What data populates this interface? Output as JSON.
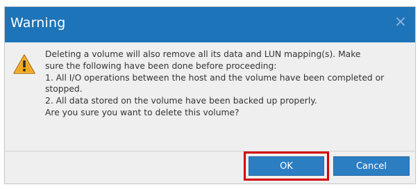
{
  "dialog": {
    "title": "Warning",
    "close_glyph": "×",
    "icon": "warning-triangle-icon",
    "message_lines": [
      "Deleting a volume will also remove all its data and LUN mapping(s). Make",
      "sure the following have been done before proceeding:",
      "1. All I/O operations between the host and the volume have been completed or",
      "stopped.",
      "2. All data stored on the volume have been backed up properly.",
      "Are you sure you want to delete this volume?"
    ],
    "buttons": {
      "ok_label": "OK",
      "cancel_label": "Cancel"
    }
  },
  "colors": {
    "titlebar": "#1e74b8",
    "button": "#2c7ec3",
    "highlight": "#d40000",
    "warning_fill": "#f2a81e"
  }
}
